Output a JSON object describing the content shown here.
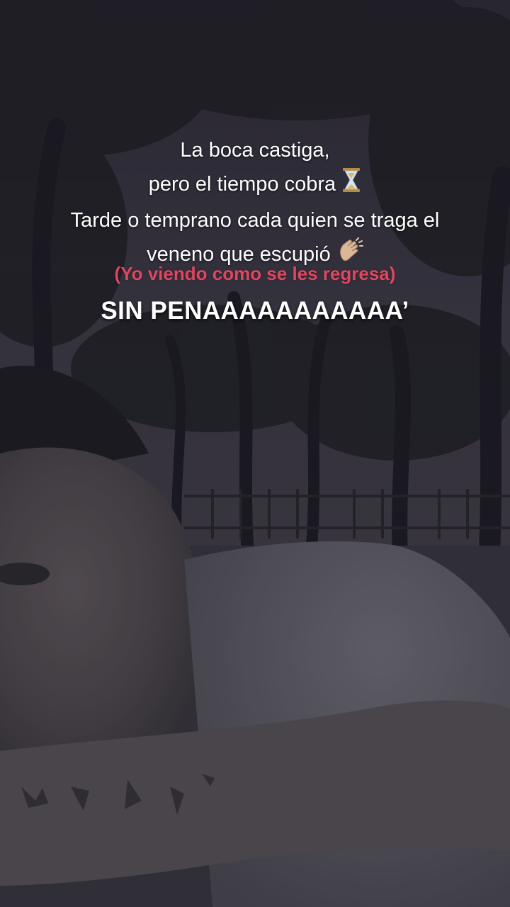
{
  "caption": {
    "line1": "La boca castiga,",
    "line2": "pero el tiempo cobra",
    "line3": "Tarde o temprano cada quien se traga el",
    "line4": "veneno que escupió"
  },
  "overlay_red": "(Yo viendo como se les regresa)",
  "overlay_main": "SIN PENAAAAAAAAAAA’",
  "emojis": {
    "hourglass": "hourglass-icon",
    "clap": "clapping-hands-icon"
  },
  "colors": {
    "caption": "#ffffff",
    "overlay_red": "#e0465e",
    "overlay_main": "#ffffff"
  }
}
